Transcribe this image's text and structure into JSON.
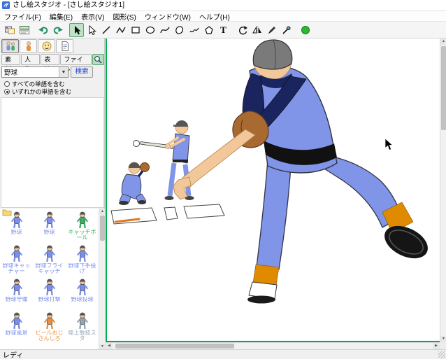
{
  "window": {
    "title": "さし絵スタジオ - [さし絵スタジオ1]"
  },
  "menu": {
    "items": [
      "ファイル(F)",
      "編集(E)",
      "表示(V)",
      "図形(S)",
      "ウィンドウ(W)",
      "ヘルプ(H)"
    ]
  },
  "toolbar": {
    "text_glyph": "T"
  },
  "panel": {
    "tabs": {
      "material": "素材",
      "person": "人物",
      "expression": "表情",
      "file": "ファイル"
    },
    "search": {
      "value": "野球",
      "button_label": "検索"
    },
    "filters": {
      "all_label": "すべての単語を含む",
      "any_label": "いずれかの単語を含む",
      "selected": "any"
    },
    "library": {
      "items": [
        {
          "label": "野球",
          "color": "#7b8fe8",
          "folder": true
        },
        {
          "label": "野球",
          "color": "#7b8fe8"
        },
        {
          "label": "キャッチボール",
          "color": "#3fae62"
        },
        {
          "label": "野球キャッチャー",
          "color": "#7b8fe8"
        },
        {
          "label": "野球フライキャッチ",
          "color": "#7b8fe8"
        },
        {
          "label": "野球下手投げ",
          "color": "#7b8fe8"
        },
        {
          "label": "野球守備",
          "color": "#7b8fe8"
        },
        {
          "label": "野球打撃",
          "color": "#7b8fe8"
        },
        {
          "label": "野球投球",
          "color": "#7b8fe8"
        },
        {
          "label": "野球風景",
          "color": "#7b8fe8"
        },
        {
          "label": "ビールおじさんしろ",
          "color": "#e8913a"
        },
        {
          "label": "陸上競技スタ",
          "color": "#93a5b5"
        }
      ]
    }
  },
  "statusbar": {
    "text": "レディ"
  },
  "colors": {
    "uniform": "#8095e8",
    "sleeve": "#1a2560",
    "skin": "#f2c79a",
    "glove": "#a96a32",
    "sock": "#e08a00",
    "page_frame": "#00b050",
    "tool_active": "#bfe3c8"
  }
}
